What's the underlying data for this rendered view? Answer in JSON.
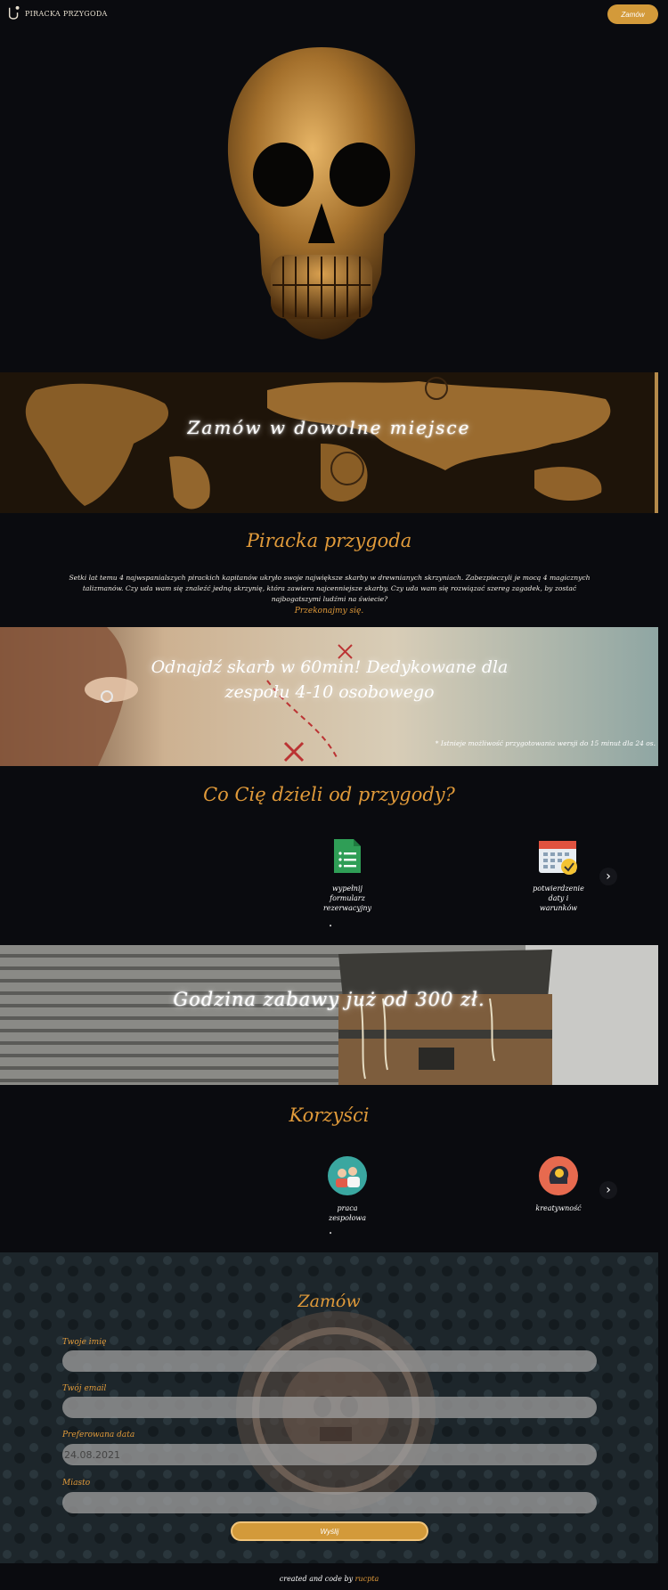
{
  "header": {
    "logo_text": "PIRACKA PRZYGODA",
    "order_button": "Zamów"
  },
  "map_banner": {
    "title": "Zamów w dowolne miejsce"
  },
  "about": {
    "title": "Piracka przygoda",
    "text": "Setki lat temu 4 najwspanialszych pirackich kapitanów ukryło swoje największe skarby w drewnianych skrzyniach. Zabezpieczyli je mocą 4 magicznych talizmanów. Czy uda wam się znaleźć jedną skrzynię, która zawiera najcenniejsze skarby. Czy uda wam się rozwiązać szereg zagadek, by zostać najbogatszymi ludźmi na świecie?",
    "link": "Przekonajmy się."
  },
  "treasure_banner": {
    "title": "Odnajdź skarb w 60min! Dedykowane dla zespołu 4-10 osobowego",
    "note": "* Istnieje możliwość przygotowania wersji do 15 minut dla 24 os."
  },
  "steps": {
    "title": "Co Cię dzieli od przygody?",
    "items": [
      {
        "label": "wypełnij formularz rezerwacyjny",
        "icon": "form-icon"
      },
      {
        "label": "potwierdzenie daty i warunków",
        "icon": "calendar-check-icon"
      }
    ],
    "next": "›",
    "dot": "•"
  },
  "chest_banner": {
    "title": "Godzina zabawy już od 300 zł."
  },
  "benefits": {
    "title": "Korzyści",
    "items": [
      {
        "label": "praca zespołowa",
        "icon": "teamwork-icon"
      },
      {
        "label": "kreatywność",
        "icon": "creativity-icon"
      }
    ],
    "next": "›",
    "dot": "•"
  },
  "form": {
    "title": "Zamów",
    "fields": [
      {
        "label": "Twoje imię",
        "value": ""
      },
      {
        "label": "Twój email",
        "value": ""
      },
      {
        "label": "Preferowana data",
        "value": "24.08.2021"
      },
      {
        "label": "Miasto",
        "value": ""
      }
    ],
    "submit": "Wyślij"
  },
  "footer": {
    "text": "created and code by",
    "author": "rucpta"
  },
  "colors": {
    "accent": "#e09a3a",
    "button": "#d39a3a",
    "background": "#0a0b0f"
  }
}
